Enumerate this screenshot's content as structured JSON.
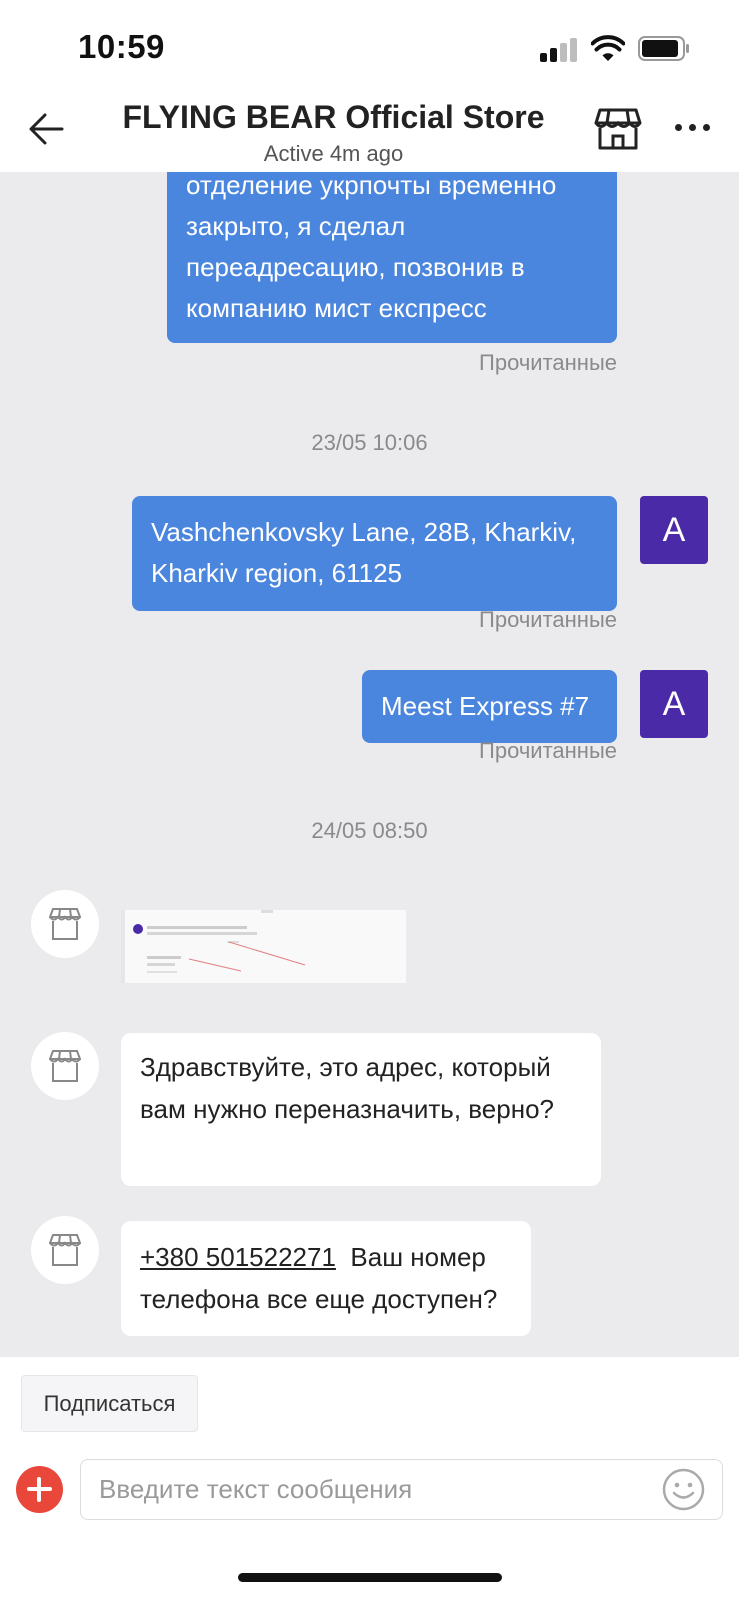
{
  "status_bar": {
    "time": "10:59",
    "icons": [
      "cellular-signal-icon",
      "wifi-icon",
      "battery-icon"
    ]
  },
  "header": {
    "title": "FLYING BEAR Official Store",
    "subtitle": "Active 4m ago",
    "icons": [
      "back-arrow-icon",
      "store-icon",
      "more-icon"
    ]
  },
  "chat": {
    "messages_out": [
      {
        "text": "отделение укрпочты временно закрыто, я сделал переадресацию, позвонив в компанию мист експресс",
        "status": "Прочитанные"
      },
      {
        "text": "Vashchenkovsky Lane, 28B, Kharkiv, Kharkiv region, 61125",
        "status": "Прочитанные",
        "avatar": "A"
      },
      {
        "text": "Meest Express #7",
        "status": "Прочитанные",
        "avatar": "A"
      }
    ],
    "date_separators": [
      "23/05 10:06",
      "24/05 08:50"
    ],
    "messages_in": [
      {
        "type": "image",
        "icon": "store-avatar-icon"
      },
      {
        "text": "Здравствуйте, это адрес, который вам нужно переназначить, верно?",
        "icon": "store-avatar-icon"
      },
      {
        "phone": "+380 501522271",
        "text": "Ваш номер телефона все еще доступен?",
        "icon": "store-avatar-icon"
      }
    ]
  },
  "footer": {
    "subscribe_label": "Подписаться",
    "input_placeholder": "Введите текст сообщения",
    "icons": [
      "add-icon",
      "emoji-icon"
    ]
  },
  "colors": {
    "outgoing_bubble": "#4a86de",
    "user_avatar": "#4a2aa6",
    "chat_background": "#ebebee",
    "add_button": "#e8473a"
  }
}
